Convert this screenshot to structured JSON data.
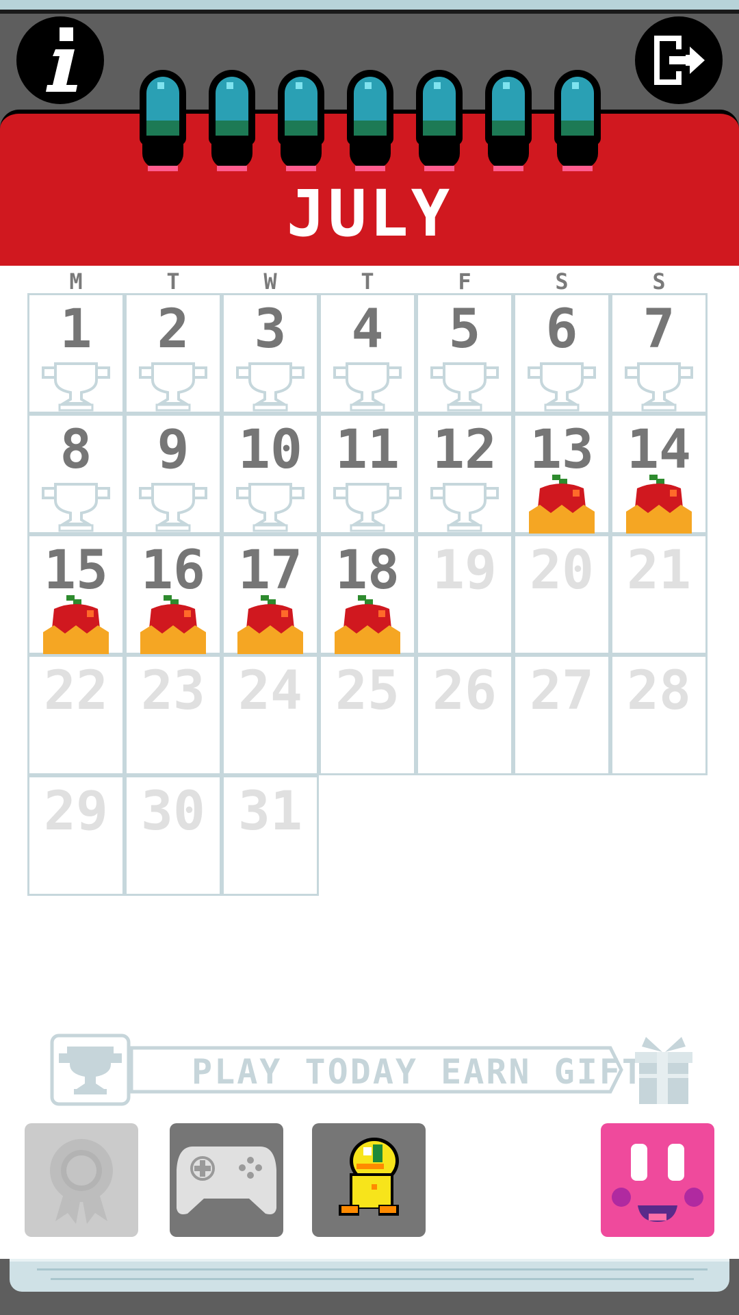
{
  "calendar": {
    "month": "JULY",
    "weekdays": [
      "M",
      "T",
      "W",
      "T",
      "F",
      "S",
      "S"
    ],
    "days": [
      {
        "day": "1",
        "status": "trophy-empty"
      },
      {
        "day": "2",
        "status": "trophy-empty"
      },
      {
        "day": "3",
        "status": "trophy-empty"
      },
      {
        "day": "4",
        "status": "trophy-empty"
      },
      {
        "day": "5",
        "status": "trophy-empty"
      },
      {
        "day": "6",
        "status": "trophy-empty"
      },
      {
        "day": "7",
        "status": "trophy-empty"
      },
      {
        "day": "8",
        "status": "trophy-empty"
      },
      {
        "day": "9",
        "status": "trophy-empty"
      },
      {
        "day": "10",
        "status": "trophy-empty"
      },
      {
        "day": "11",
        "status": "trophy-empty"
      },
      {
        "day": "12",
        "status": "trophy-empty"
      },
      {
        "day": "13",
        "status": "apple-cake"
      },
      {
        "day": "14",
        "status": "apple-cake"
      },
      {
        "day": "15",
        "status": "apple-cake"
      },
      {
        "day": "16",
        "status": "apple-cake"
      },
      {
        "day": "17",
        "status": "apple-cake"
      },
      {
        "day": "18",
        "status": "apple-cake"
      },
      {
        "day": "19",
        "status": "future"
      },
      {
        "day": "20",
        "status": "future"
      },
      {
        "day": "21",
        "status": "future"
      },
      {
        "day": "22",
        "status": "future"
      },
      {
        "day": "23",
        "status": "future"
      },
      {
        "day": "24",
        "status": "future"
      },
      {
        "day": "25",
        "status": "future"
      },
      {
        "day": "26",
        "status": "future"
      },
      {
        "day": "27",
        "status": "future"
      },
      {
        "day": "28",
        "status": "future"
      },
      {
        "day": "29",
        "status": "future"
      },
      {
        "day": "30",
        "status": "future"
      },
      {
        "day": "31",
        "status": "future"
      }
    ]
  },
  "banner": {
    "text": "PLAY TODAY EARN GIFTS",
    "left_icon": "trophy-icon",
    "right_icon": "gift-icon"
  },
  "header": {
    "left_icon": "info-icon",
    "right_icon": "exit-icon",
    "rings": 7
  },
  "bottom_bar": [
    {
      "name": "awards-button",
      "icon": "ribbon-badge-icon"
    },
    {
      "name": "games-button",
      "icon": "gamepad-icon"
    },
    {
      "name": "character-button",
      "icon": "yellow-bird-icon"
    },
    {
      "name": "blob-button",
      "icon": "pink-face-icon"
    }
  ],
  "colors": {
    "header_red": "#d0181f",
    "grid_line": "#c6d7dc",
    "past_number": "#767676",
    "future_number": "#e0e0e0",
    "pink": "#ef4a9c",
    "ring_teal": "#2aa0b4"
  }
}
